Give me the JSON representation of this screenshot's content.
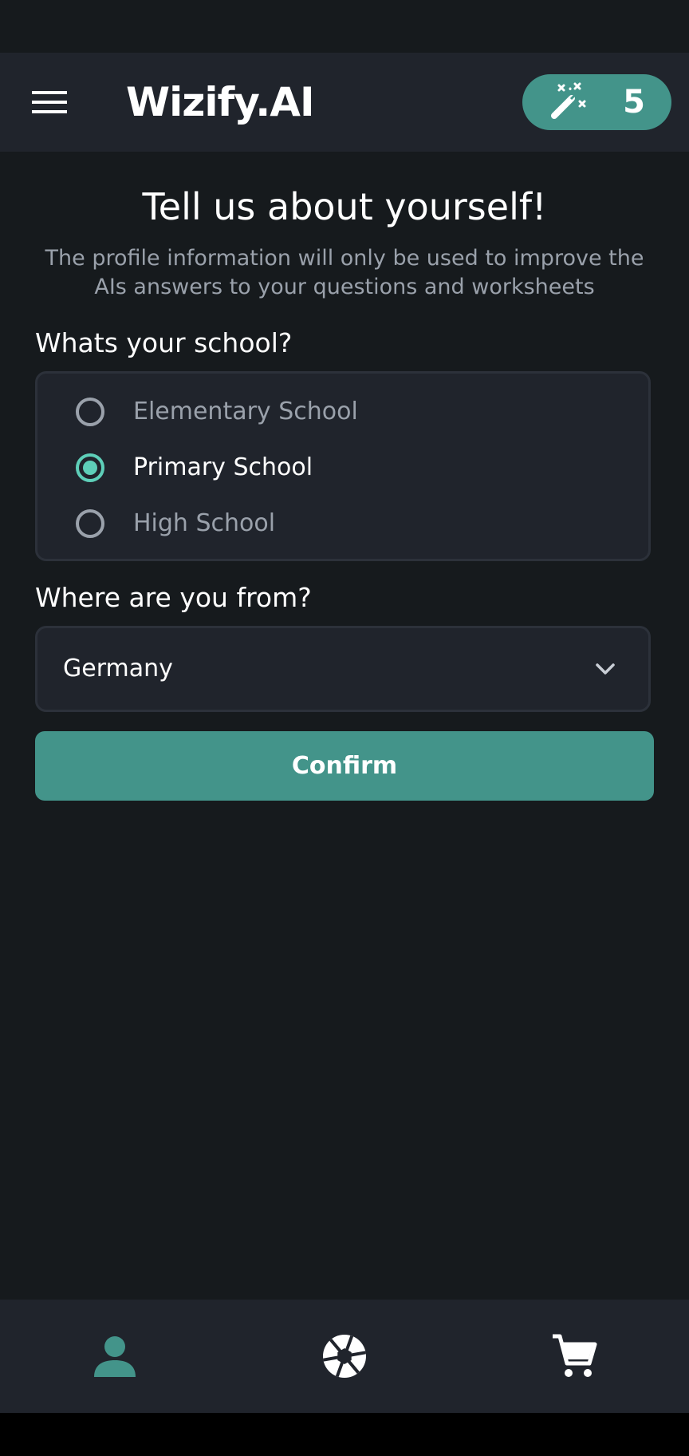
{
  "header": {
    "title": "Wizify.AI",
    "credits": "5",
    "menu_icon": "hamburger-menu-icon",
    "credits_icon": "magic-wand-icon"
  },
  "intro": {
    "title": "Tell us about yourself!",
    "subtitle": "The profile information will only be used to improve the AIs answers to your questions and worksheets"
  },
  "school": {
    "label": "Whats your school?",
    "options": [
      {
        "label": "Elementary School",
        "selected": false
      },
      {
        "label": "Primary School",
        "selected": true
      },
      {
        "label": "High School",
        "selected": false
      }
    ]
  },
  "country": {
    "label": "Where are you from?",
    "value": "Germany"
  },
  "confirm_label": "Confirm",
  "bottom_nav": {
    "items": [
      {
        "icon": "person-icon",
        "active": true
      },
      {
        "icon": "camera-aperture-icon",
        "active": false
      },
      {
        "icon": "shopping-cart-icon",
        "active": false
      }
    ]
  },
  "colors": {
    "accent": "#43948a",
    "radio_selected": "#5ecfb9",
    "background": "#161a1d",
    "surface": "#20242c",
    "muted_text": "#9aa1ab"
  }
}
